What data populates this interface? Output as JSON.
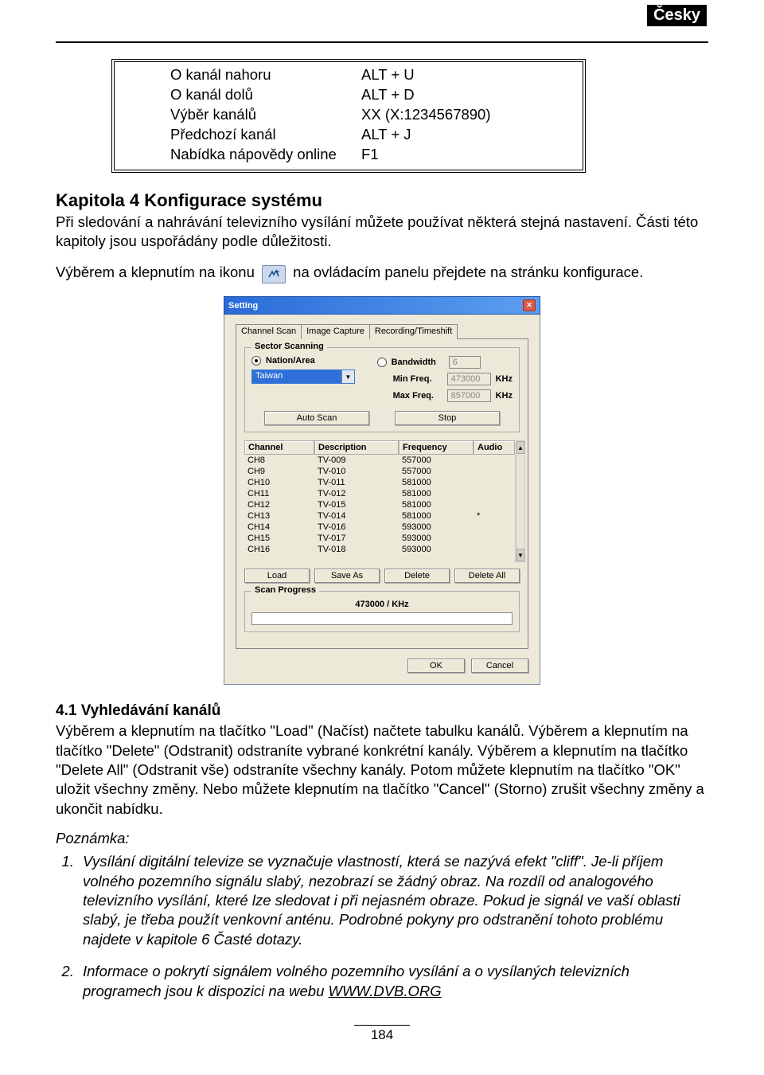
{
  "language_badge": "Česky",
  "shortcuts": [
    {
      "k": "O kanál nahoru",
      "v": "ALT + U"
    },
    {
      "k": "O kanál dolů",
      "v": "ALT + D"
    },
    {
      "k": "Výběr kanálů",
      "v": "XX (X:1234567890)"
    },
    {
      "k": "Předchozí kanál",
      "v": "ALT + J"
    },
    {
      "k": "Nabídka nápovědy online",
      "v": "F1"
    }
  ],
  "heading": "Kapitola 4 Konfigurace systému",
  "para1": "Při sledování a nahrávání televizního vysílání můžete používat některá stejná nastavení. Části této kapitoly jsou uspořádány podle důležitosti.",
  "icon_pre": "Výběrem a klepnutím na ikonu ",
  "icon_post": " na ovládacím panelu přejdete na stránku konfigurace.",
  "dialog": {
    "title": "Setting",
    "tabs": [
      "Channel Scan",
      "Image Capture",
      "Recording/Timeshift"
    ],
    "sector_legend": "Sector Scanning",
    "nation_label": "Nation/Area",
    "nation_value": "Taiwan",
    "bandwidth_label": "Bandwidth",
    "bandwidth_value": "6",
    "minfreq_label": "Min Freq.",
    "minfreq_value": "473000",
    "maxfreq_label": "Max Freq.",
    "maxfreq_value": "857000",
    "khz": "KHz",
    "autoscan": "Auto Scan",
    "stop": "Stop",
    "columns": [
      "Channel",
      "Description",
      "Frequency",
      "Audio"
    ],
    "rows": [
      {
        "ch": "CH8",
        "desc": "TV-009",
        "freq": "557000",
        "audio": ""
      },
      {
        "ch": "CH9",
        "desc": "TV-010",
        "freq": "557000",
        "audio": ""
      },
      {
        "ch": "CH10",
        "desc": "TV-011",
        "freq": "581000",
        "audio": ""
      },
      {
        "ch": "CH11",
        "desc": "TV-012",
        "freq": "581000",
        "audio": ""
      },
      {
        "ch": "CH12",
        "desc": "TV-015",
        "freq": "581000",
        "audio": ""
      },
      {
        "ch": "CH13",
        "desc": "TV-014",
        "freq": "581000",
        "audio": "*"
      },
      {
        "ch": "CH14",
        "desc": "TV-016",
        "freq": "593000",
        "audio": ""
      },
      {
        "ch": "CH15",
        "desc": "TV-017",
        "freq": "593000",
        "audio": ""
      },
      {
        "ch": "CH16",
        "desc": "TV-018",
        "freq": "593000",
        "audio": ""
      }
    ],
    "load": "Load",
    "saveas": "Save As",
    "delete": "Delete",
    "deleteall": "Delete All",
    "progress_legend": "Scan Progress",
    "progress_text": "473000   /   KHz",
    "ok": "OK",
    "cancel": "Cancel"
  },
  "subheading": "4.1 Vyhledávání kanálů",
  "para2": "Výběrem a klepnutím na tlačítko \"Load\" (Načíst) načtete tabulku kanálů. Výběrem a klepnutím na tlačítko \"Delete\" (Odstranit) odstraníte vybrané konkrétní kanály. Výběrem a klepnutím na tlačítko \"Delete All\" (Odstranit vše) odstraníte všechny kanály. Potom můžete klepnutím na tlačítko \"OK\" uložit všechny změny. Nebo můžete klepnutím na tlačítko \"Cancel\" (Storno) zrušit všechny změny a ukončit nabídku.",
  "note_label": "Poznámka:",
  "notes": [
    "Vysílání digitální televize se vyznačuje vlastností, která se nazývá efekt \"cliff\". Je-li příjem volného pozemního signálu slabý, nezobrazí se žádný obraz. Na rozdíl od analogového televizního vysílání, které lze sledovat i při nejasném obraze. Pokud je signál ve vaší oblasti slabý, je třeba použít venkovní anténu. Podrobné pokyny pro odstranění tohoto problému najdete v kapitole 6 Časté dotazy.",
    "Informace o pokrytí signálem volného pozemního vysílání a o vysílaných televizních programech jsou k dispozici na webu "
  ],
  "link_text": "WWW.DVB.ORG",
  "page_number": "184"
}
